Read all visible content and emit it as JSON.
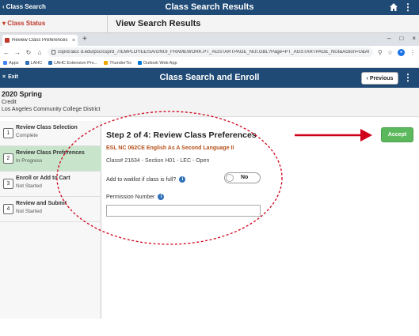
{
  "top_bar": {
    "back_label": "Class Search",
    "title": "Class Search Results"
  },
  "underlying_page": {
    "class_status": "Class Status",
    "view_results": "View Search Results"
  },
  "browser": {
    "tab_label": "Review Class Preferences",
    "url": "csprd.lacc d.edu/psc/csprd_7/EMPLOYEE/SA/c/NUI_FRAMEWORK.PT_AGSTARTPAGE_NUI.GBL?Page=PT_AGSTARTPAGE_NUI&Action=U&ACAD_CAREER=&...",
    "bookmarks": [
      "Apps",
      "LAHC",
      "LAHC Extension Pro...",
      "ThunderTix",
      "Outlook Web App"
    ]
  },
  "app_header": {
    "exit_label": "Exit",
    "title": "Class Search and Enroll",
    "previous_label": "Previous"
  },
  "term": {
    "name": "2020 Spring",
    "career": "Credit",
    "institution": "Los Angeles Community College District"
  },
  "steps": [
    {
      "num": "1",
      "title": "Review Class Selection",
      "status": "Complete",
      "active": false
    },
    {
      "num": "2",
      "title": "Review Class Preferences",
      "status": "In Progress",
      "active": true
    },
    {
      "num": "3",
      "title": "Enroll or Add to Cart",
      "status": "Not Started",
      "active": false
    },
    {
      "num": "4",
      "title": "Review and Submit",
      "status": "Not Started",
      "active": false
    }
  ],
  "main": {
    "heading": "Step 2 of 4: Review Class Preferences",
    "course": "ESL NC 062CE   English As A Second Language II",
    "class_info": "Class# 21634 - Section H01 - LEC - Open",
    "waitlist_label": "Add to waitlist if class is full?",
    "waitlist_value": "No",
    "permission_label": "Permission Number",
    "permission_value": "",
    "accept_label": "Accept"
  },
  "colors": {
    "header": "#1f4a75",
    "accept": "#5cb85c",
    "active_step": "#c8e5cb",
    "annotation": "#d0021b"
  }
}
